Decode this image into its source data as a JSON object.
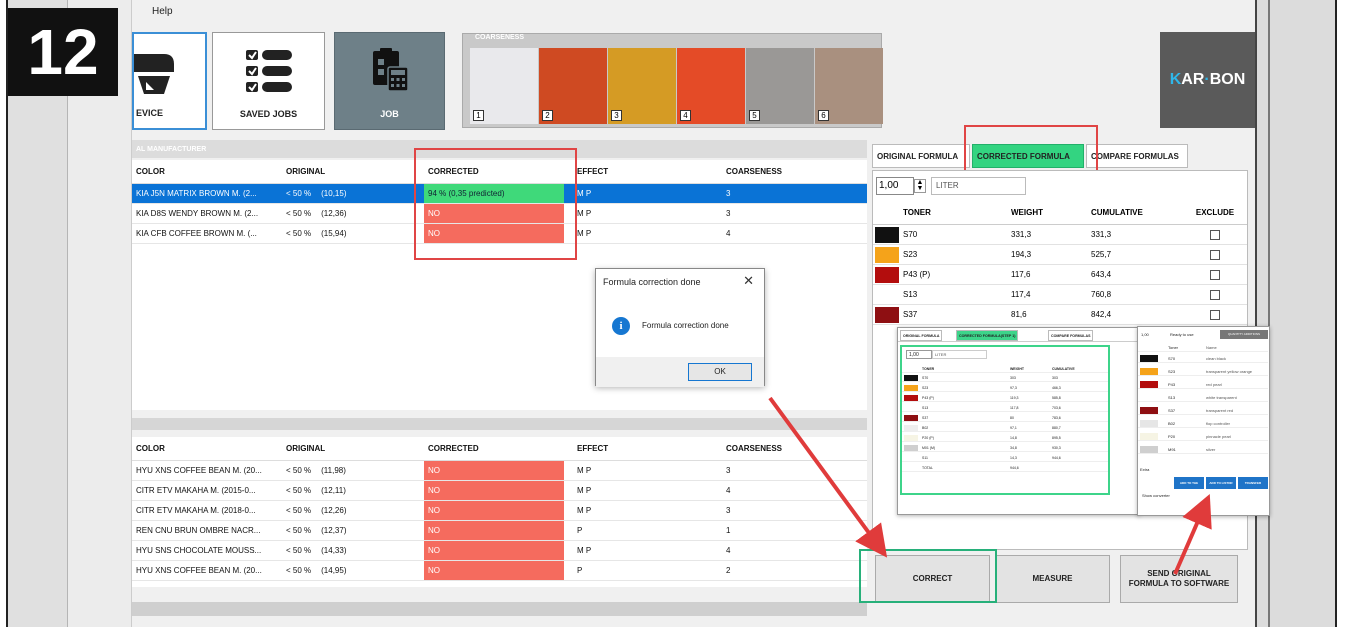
{
  "step_badge": "12",
  "menu": {
    "help": "Help"
  },
  "toolbar": {
    "device_label": "EVICE",
    "saved_jobs_label": "SAVED JOBS",
    "job_label": "JOB"
  },
  "coarseness": {
    "title": "COARSENESS",
    "swatches": [
      {
        "num": "1",
        "color": "#e9e9ec"
      },
      {
        "num": "2",
        "color": "#cf4a22"
      },
      {
        "num": "3",
        "color": "#d59b24"
      },
      {
        "num": "4",
        "color": "#e44b27"
      },
      {
        "num": "5",
        "color": "#9a9896"
      },
      {
        "num": "6",
        "color": "#a9907f"
      }
    ]
  },
  "logo": {
    "part1": "K",
    "part2": "AR",
    "sep": "·",
    "part3": "BON"
  },
  "manufacturer_header": "AL MANUFACTURER",
  "grid_top": {
    "headers": {
      "color": "COLOR",
      "original": "ORIGINAL",
      "corrected": "CORRECTED",
      "effect": "EFFECT",
      "coarseness": "COARSENESS"
    },
    "rows": [
      {
        "color": "KIA J5N MATRIX BROWN M. (2...",
        "pct": "< 50 %",
        "orig": "(10,15)",
        "corr": "94 %    (0,35 predicted)",
        "effect": "M P",
        "coarse": "3"
      },
      {
        "color": "KIA D8S WENDY BROWN M. (2...",
        "pct": "< 50 %",
        "orig": "(12,36)",
        "corr": "NO",
        "effect": "M P",
        "coarse": "3"
      },
      {
        "color": "KIA CFB COFFEE BROWN M. (...",
        "pct": "< 50 %",
        "orig": "(15,94)",
        "corr": "NO",
        "effect": "M P",
        "coarse": "4"
      }
    ]
  },
  "grid_bottom": {
    "headers": {
      "color": "COLOR",
      "original": "ORIGINAL",
      "corrected": "CORRECTED",
      "effect": "EFFECT",
      "coarseness": "COARSENESS"
    },
    "rows": [
      {
        "color": "HYU XNS COFFEE BEAN M. (20...",
        "pct": "< 50 %",
        "orig": "(11,98)",
        "corr": "NO",
        "effect": "M P",
        "coarse": "3"
      },
      {
        "color": "CITR ETV MAKAHA M. (2015-0...",
        "pct": "< 50 %",
        "orig": "(12,11)",
        "corr": "NO",
        "effect": "M P",
        "coarse": "4"
      },
      {
        "color": "CITR ETV MAKAHA M. (2018-0...",
        "pct": "< 50 %",
        "orig": "(12,26)",
        "corr": "NO",
        "effect": "M P",
        "coarse": "3"
      },
      {
        "color": "REN CNU BRUN OMBRE NACR...",
        "pct": "< 50 %",
        "orig": "(12,37)",
        "corr": "NO",
        "effect": "P",
        "coarse": "1"
      },
      {
        "color": "HYU SNS CHOCOLATE MOUSS...",
        "pct": "< 50 %",
        "orig": "(14,33)",
        "corr": "NO",
        "effect": "M P",
        "coarse": "4"
      },
      {
        "color": "HYU XNS COFFEE BEAN M. (20...",
        "pct": "< 50 %",
        "orig": "(14,95)",
        "corr": "NO",
        "effect": "P",
        "coarse": "2"
      }
    ]
  },
  "formula_tabs": {
    "original": "ORIGINAL FORMULA",
    "corrected": "CORRECTED FORMULA",
    "compare": "COMPARE FORMULAS"
  },
  "quantity": {
    "value": "1,00",
    "unit": "LITER"
  },
  "toner_table": {
    "headers": {
      "toner": "TONER",
      "weight": "WEIGHT",
      "cumulative": "CUMULATIVE",
      "exclude": "EXCLUDE"
    },
    "rows": [
      {
        "color": "#111111",
        "name": "S70",
        "weight": "331,3",
        "cum": "331,3"
      },
      {
        "color": "#f5a31a",
        "name": "S23",
        "weight": "194,3",
        "cum": "525,7"
      },
      {
        "color": "#b30d0d",
        "name": "P43 (P)",
        "weight": "117,6",
        "cum": "643,4"
      },
      {
        "color": "#ffffff",
        "name": "S13",
        "weight": "117,4",
        "cum": "760,8"
      },
      {
        "color": "#8e0f12",
        "name": "S37",
        "weight": "81,6",
        "cum": "842,4"
      }
    ]
  },
  "buttons": {
    "correct": "CORRECT",
    "measure": "MEASURE",
    "send_line1": "SEND ORIGINAL",
    "send_line2": "FORMULA TO SOFTWARE"
  },
  "dialog": {
    "title": "Formula correction done",
    "message": "Formula correction done",
    "ok": "OK",
    "close": "✕"
  },
  "overlay_a": {
    "tabs": [
      "ORIGINAL FORMULA",
      "CORRECTED FORMULA(STEP 1)",
      "COMPARE FORMULAS"
    ],
    "qty": "1,00",
    "unit": "LITER",
    "headers": {
      "toner": "TONER",
      "weight": "WEIGHT",
      "cumulative": "CUMULATIVE"
    },
    "rows": [
      {
        "color": "#111111",
        "name": "S70",
        "weight": "303",
        "cum": "303"
      },
      {
        "color": "#f5a31a",
        "name": "S23",
        "weight": "97,3",
        "cum": "466,3"
      },
      {
        "color": "#b30d0d",
        "name": "P43 (P)",
        "weight": "119,3",
        "cum": "585,8"
      },
      {
        "color": "#ffffff",
        "name": "S13",
        "weight": "117,8",
        "cum": "703,6"
      },
      {
        "color": "#8e0f12",
        "name": "S37",
        "weight": "80",
        "cum": "783,6"
      },
      {
        "color": "#eeeeee",
        "name": "B02",
        "weight": "97,1",
        "cum": "880,7"
      },
      {
        "color": "#f6f4e4",
        "name": "P20 (P)",
        "weight": "14,8",
        "cum": "895,5"
      },
      {
        "color": "#cfcfcf",
        "name": "M01 (M)",
        "weight": "34,8",
        "cum": "930,3"
      },
      {
        "color": "#ffffff",
        "name": "S11",
        "weight": "14,3",
        "cum": "944,6"
      },
      {
        "color": "#ffffff",
        "name": "TOTAL",
        "weight": "944,6",
        "cum": ""
      }
    ]
  },
  "overlay_b": {
    "qty": "1,00",
    "ready": "Ready to use",
    "header_btn": "QUANTITY ADDITIONS",
    "headers": {
      "toner": "Toner",
      "name": "Name"
    },
    "rows": [
      {
        "color": "#111111",
        "name": "S70",
        "desc": "clean black"
      },
      {
        "color": "#f5a31a",
        "name": "S23",
        "desc": "transparent yellow orange"
      },
      {
        "color": "#b30d0d",
        "name": "P43",
        "desc": "red pearl"
      },
      {
        "color": "#ffffff",
        "name": "S13",
        "desc": "white transparent"
      },
      {
        "color": "#8e0f12",
        "name": "S37",
        "desc": "transparent red"
      },
      {
        "color": "#e6e6e6",
        "name": "B02",
        "desc": "flop controller"
      },
      {
        "color": "#f6f4e4",
        "name": "P20",
        "desc": "pinnacle pearl"
      },
      {
        "color": "#cfcfcf",
        "name": "M91",
        "desc": "silver"
      }
    ],
    "btn1": "ADD TO THE REPORT",
    "btn2": "ADD TO LISTOR",
    "btn3": "TRANSFER",
    "extra": "Extra",
    "checkbox_label": "Show converter"
  }
}
